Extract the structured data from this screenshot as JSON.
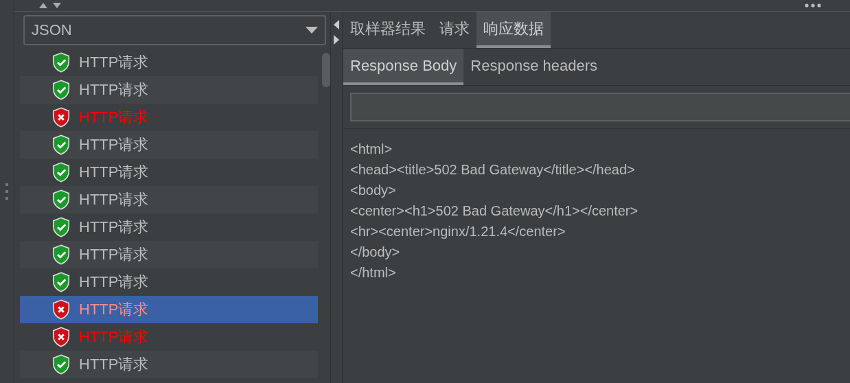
{
  "renderer_dropdown": {
    "value": "JSON"
  },
  "results": [
    {
      "label": "HTTP请求",
      "kind": "success",
      "selected": false
    },
    {
      "label": "HTTP请求",
      "kind": "success",
      "selected": false
    },
    {
      "label": "HTTP请求",
      "kind": "error",
      "selected": false
    },
    {
      "label": "HTTP请求",
      "kind": "success",
      "selected": false
    },
    {
      "label": "HTTP请求",
      "kind": "success",
      "selected": false
    },
    {
      "label": "HTTP请求",
      "kind": "success",
      "selected": false
    },
    {
      "label": "HTTP请求",
      "kind": "success",
      "selected": false
    },
    {
      "label": "HTTP请求",
      "kind": "success",
      "selected": false
    },
    {
      "label": "HTTP请求",
      "kind": "success",
      "selected": false
    },
    {
      "label": "HTTP请求",
      "kind": "error",
      "selected": true
    },
    {
      "label": "HTTP请求",
      "kind": "error",
      "selected": false
    },
    {
      "label": "HTTP请求",
      "kind": "success",
      "selected": false
    }
  ],
  "tabs": [
    {
      "label": "取样器结果",
      "selected": false
    },
    {
      "label": "请求",
      "selected": false
    },
    {
      "label": "响应数据",
      "selected": true
    }
  ],
  "subtabs": [
    {
      "label": "Response Body",
      "selected": true
    },
    {
      "label": "Response headers",
      "selected": false
    }
  ],
  "response_body": [
    "<html>",
    "<head><title>502 Bad Gateway</title></head>",
    "<body>",
    "<center><h1>502 Bad Gateway</h1></center>",
    "<hr><center>nginx/1.21.4</center>",
    "</body>",
    "</html>"
  ]
}
